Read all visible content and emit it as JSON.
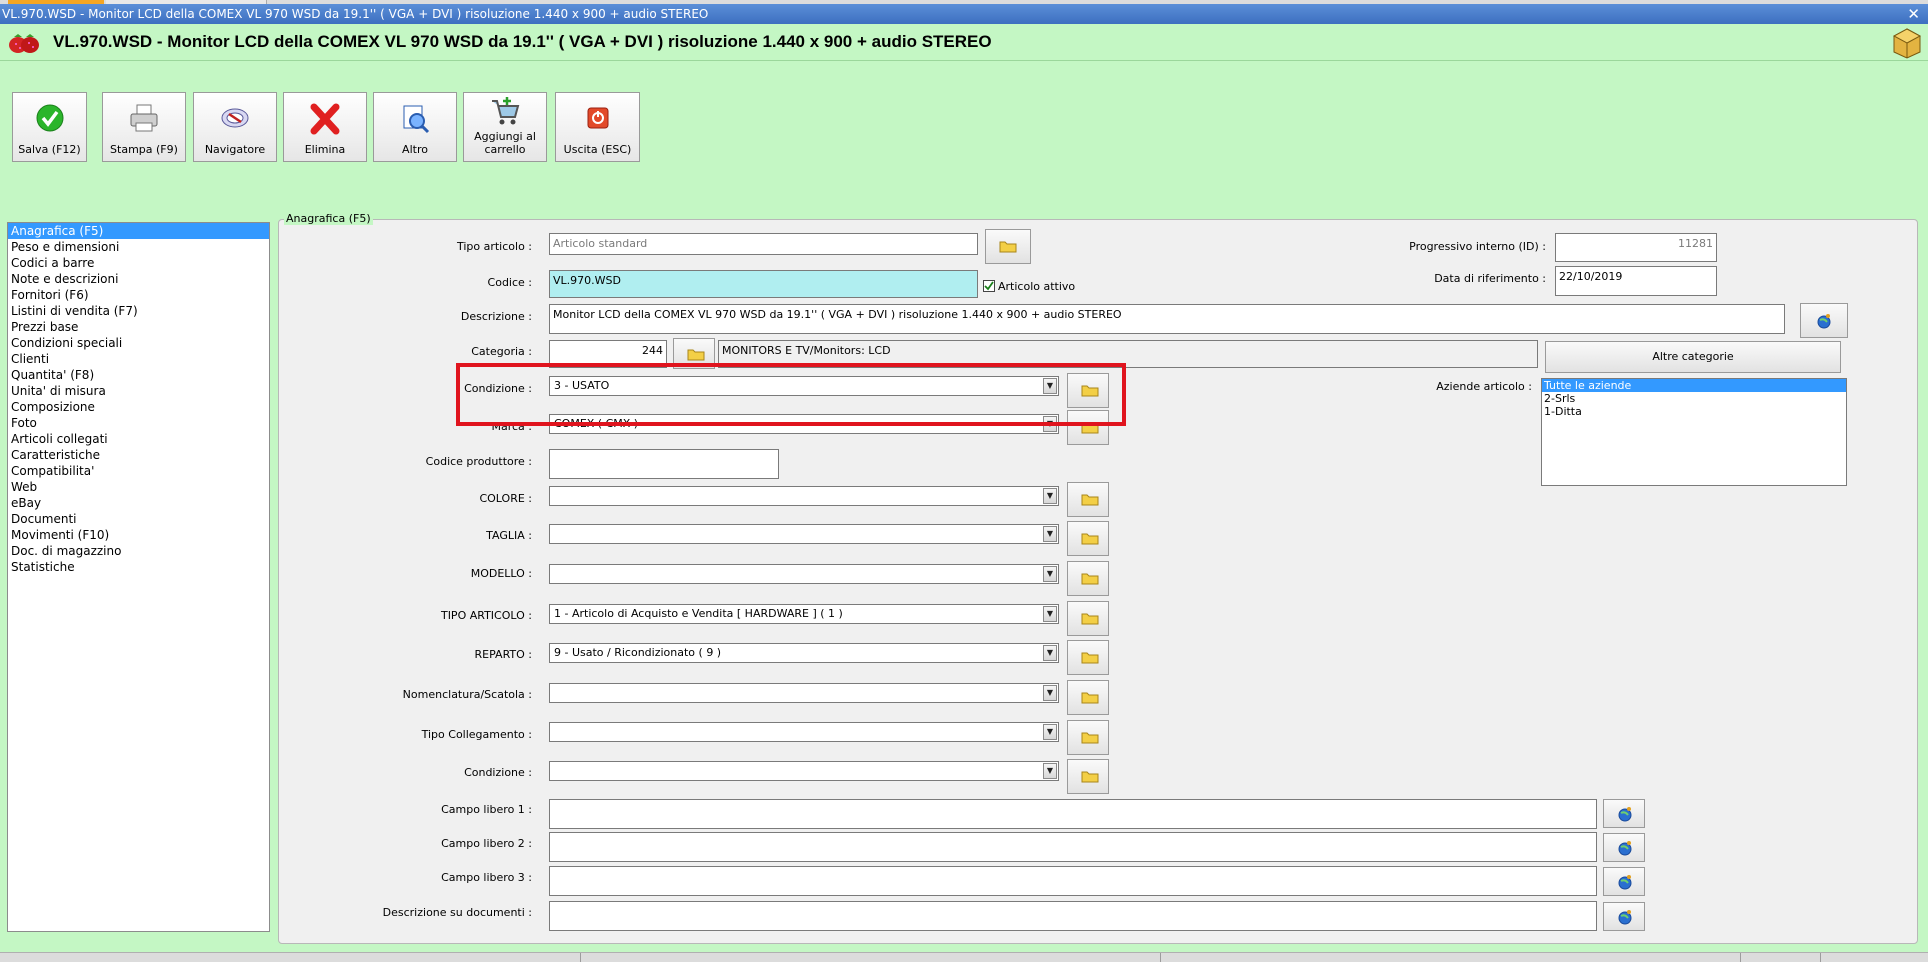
{
  "window": {
    "title": "VL.970.WSD - Monitor LCD della COMEX VL 970 WSD da 19.1'' ( VGA + DVI ) risoluzione 1.440 x 900 + audio STEREO",
    "close_glyph": "✕"
  },
  "header": {
    "title": "VL.970.WSD - Monitor LCD della COMEX VL 970 WSD da 19.1'' ( VGA + DVI ) risoluzione 1.440 x 900 + audio STEREO"
  },
  "toolbar": {
    "buttons": [
      {
        "label": "Salva (F12)",
        "icon": "check-icon"
      },
      {
        "label": "Stampa (F9)",
        "icon": "printer-icon"
      },
      {
        "label": "Navigatore",
        "icon": "compass-icon"
      },
      {
        "label": "Elimina",
        "icon": "delete-x-icon"
      },
      {
        "label": "Altro",
        "icon": "search-document-icon"
      },
      {
        "label": "Aggiungi al carrello",
        "icon": "cart-icon"
      },
      {
        "label": "Uscita (ESC)",
        "icon": "power-icon"
      }
    ]
  },
  "sidebar": {
    "items": [
      "Anagrafica (F5)",
      "Peso e dimensioni",
      "Codici a barre",
      "Note e descrizioni",
      "Fornitori (F6)",
      "Listini di vendita (F7)",
      "Prezzi base",
      "Condizioni speciali",
      "Clienti",
      "Quantita' (F8)",
      "Unita' di misura",
      "Composizione",
      "Foto",
      "Articoli collegati",
      "Caratteristiche",
      "Compatibilita'",
      "Web",
      "eBay",
      "Documenti",
      "Movimenti (F10)",
      "Doc. di magazzino",
      "Statistiche"
    ],
    "selected_index": 0
  },
  "form": {
    "caption": "Anagrafica (F5)",
    "tipo_articolo": {
      "label": "Tipo articolo :",
      "value": "Articolo standard"
    },
    "codice": {
      "label": "Codice :",
      "value": "VL.970.WSD"
    },
    "articolo_attivo": {
      "label": "Articolo attivo",
      "checked": true
    },
    "descrizione": {
      "label": "Descrizione :",
      "value": "Monitor LCD della COMEX VL 970 WSD da 19.1'' ( VGA + DVI ) risoluzione 1.440 x 900 + audio STEREO"
    },
    "categoria": {
      "label": "Categoria :",
      "code": "244",
      "name": "MONITORS E TV/Monitors: LCD"
    },
    "altre_categorie": "Altre categorie",
    "progressivo": {
      "label": "Progressivo interno (ID) :",
      "value": "11281"
    },
    "data_riferimento": {
      "label": "Data di riferimento :",
      "value": "22/10/2019"
    },
    "aziende": {
      "label": "Aziende articolo :",
      "items": [
        "Tutte le aziende",
        "2-Srls",
        "1-Ditta"
      ],
      "selected_index": 0
    },
    "condizione": {
      "label": "Condizione :",
      "value": "3 - USATO"
    },
    "marca": {
      "label": "Marca :",
      "value": "COMEX ( CMX )"
    },
    "codice_produttore": {
      "label": "Codice produttore :",
      "value": ""
    },
    "colore": {
      "label": "COLORE :",
      "value": ""
    },
    "taglia": {
      "label": "TAGLIA :",
      "value": ""
    },
    "modello": {
      "label": "MODELLO :",
      "value": ""
    },
    "tipo_articolo_combo": {
      "label": "TIPO ARTICOLO :",
      "value": "1 - Articolo di Acquisto e Vendita [ HARDWARE ] ( 1 )"
    },
    "reparto": {
      "label": "REPARTO :",
      "value": "9 - Usato / Ricondizionato ( 9 )"
    },
    "nomenclatura": {
      "label": "Nomenclatura/Scatola :",
      "value": ""
    },
    "tipo_collegamento": {
      "label": "Tipo Collegamento :",
      "value": ""
    },
    "condizione2": {
      "label": "Condizione :",
      "value": ""
    },
    "campo_libero_1": {
      "label": "Campo libero 1 :",
      "value": ""
    },
    "campo_libero_2": {
      "label": "Campo libero 2 :",
      "value": ""
    },
    "campo_libero_3": {
      "label": "Campo libero 3 :",
      "value": ""
    },
    "descrizione_documenti": {
      "label": "Descrizione su documenti :",
      "value": ""
    }
  },
  "colors": {
    "background": "#c4f7c4",
    "highlight": "#e0141e",
    "selection": "#3399ff",
    "codice_field": "#b0eef0"
  }
}
